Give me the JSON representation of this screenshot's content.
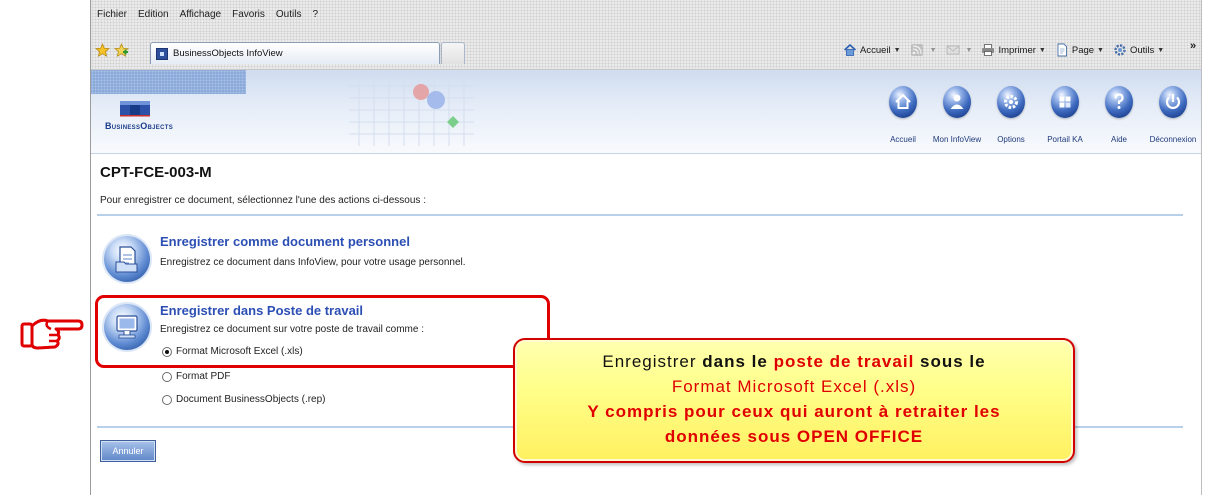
{
  "window": {
    "menu": [
      "Fichier",
      "Edition",
      "Affichage",
      "Favoris",
      "Outils",
      "?"
    ],
    "tab_label": "BusinessObjects InfoView",
    "toolbar": {
      "home": "Accueil",
      "print": "Imprimer",
      "page": "Page",
      "tools": "Outils",
      "more": "»"
    }
  },
  "header": {
    "logo": "BusinessObjects",
    "nav": [
      {
        "label": "Accueil",
        "icon": "home-icon"
      },
      {
        "label": "Mon InfoView",
        "icon": "my-infoview-icon"
      },
      {
        "label": "Options",
        "icon": "options-icon"
      },
      {
        "label": "Portail KA",
        "icon": "portal-icon"
      },
      {
        "label": "Aide",
        "icon": "help-icon"
      },
      {
        "label": "Déconnexion",
        "icon": "logout-icon"
      }
    ]
  },
  "page": {
    "title": "CPT-FCE-003-M",
    "instruction": "Pour enregistrer ce document, sélectionnez l'une des actions ci-dessous :"
  },
  "options": [
    {
      "title": "Enregistrer comme document personnel",
      "description": "Enregistrez ce document dans InfoView, pour votre usage personnel.",
      "icon": "personal-document-icon"
    },
    {
      "title": "Enregistrer dans Poste de travail",
      "description": "Enregistrez ce document sur votre poste de travail comme :",
      "icon": "workstation-icon",
      "highlighted": true,
      "formats": [
        {
          "label": "Format Microsoft Excel (.xls)",
          "checked": true
        },
        {
          "label": "Format PDF",
          "checked": false
        },
        {
          "label": "Document BusinessObjects (.rep)",
          "checked": false
        }
      ]
    }
  ],
  "actions": {
    "cancel": "Annuler"
  },
  "callout": {
    "line1": {
      "lead": "Enregistrer",
      "bold": "dans le",
      "highlight": "poste de travail",
      "tail": "sous le"
    },
    "line2": "Format Microsoft Excel (.xls)",
    "line3": "Y compris pour ceux qui auront à retraiter les",
    "line4": "données sous OPEN OFFICE"
  },
  "pointer_icon": "pointing-hand-icon",
  "colors": {
    "accent_red": "#e00000",
    "link_blue": "#2c4fb4",
    "callout_yellow": "#ffff8a",
    "separator_blue": "#b9d0ea"
  }
}
